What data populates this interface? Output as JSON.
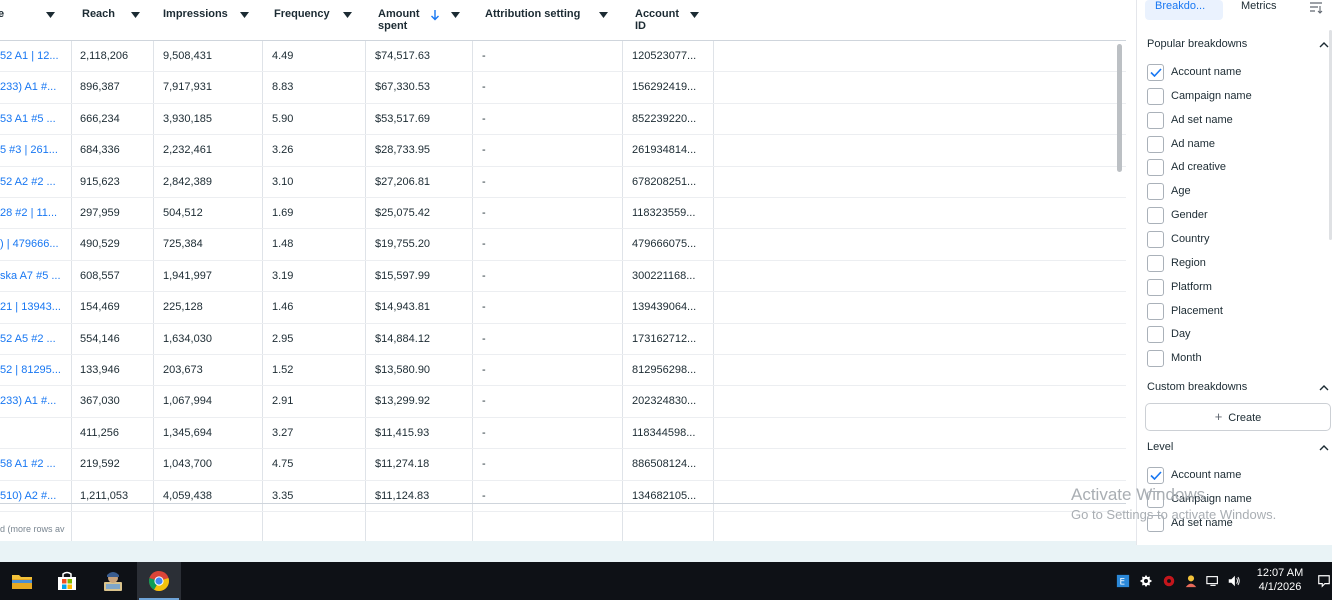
{
  "table": {
    "columns": [
      {
        "key": "name",
        "label": "e"
      },
      {
        "key": "reach",
        "label": "Reach"
      },
      {
        "key": "impressions",
        "label": "Impressions"
      },
      {
        "key": "frequency",
        "label": "Frequency"
      },
      {
        "key": "amount_spent",
        "label": "Amount spent",
        "sorted": "descending"
      },
      {
        "key": "attribution",
        "label": "Attribution setting"
      },
      {
        "key": "account_id",
        "label": "Account ID"
      }
    ],
    "rows": [
      {
        "name": "52 A1 | 12...",
        "reach": "2,118,206",
        "impressions": "9,508,431",
        "frequency": "4.49",
        "amount_spent": "$74,517.63",
        "attribution": "-",
        "account_id": "120523077..."
      },
      {
        "name": "233) A1 #...",
        "reach": "896,387",
        "impressions": "7,917,931",
        "frequency": "8.83",
        "amount_spent": "$67,330.53",
        "attribution": "-",
        "account_id": "156292419..."
      },
      {
        "name": "53 A1 #5 ...",
        "reach": "666,234",
        "impressions": "3,930,185",
        "frequency": "5.90",
        "amount_spent": "$53,517.69",
        "attribution": "-",
        "account_id": "852239220..."
      },
      {
        "name": "5 #3 | 261...",
        "reach": "684,336",
        "impressions": "2,232,461",
        "frequency": "3.26",
        "amount_spent": "$28,733.95",
        "attribution": "-",
        "account_id": "261934814..."
      },
      {
        "name": "52 A2 #2 ...",
        "reach": "915,623",
        "impressions": "2,842,389",
        "frequency": "3.10",
        "amount_spent": "$27,206.81",
        "attribution": "-",
        "account_id": "678208251..."
      },
      {
        "name": "28 #2 | 11...",
        "reach": "297,959",
        "impressions": "504,512",
        "frequency": "1.69",
        "amount_spent": "$25,075.42",
        "attribution": "-",
        "account_id": "118323559..."
      },
      {
        "name": ") | 479666...",
        "reach": "490,529",
        "impressions": "725,384",
        "frequency": "1.48",
        "amount_spent": "$19,755.20",
        "attribution": "-",
        "account_id": "479666075..."
      },
      {
        "name": "ska A7 #5 ...",
        "reach": "608,557",
        "impressions": "1,941,997",
        "frequency": "3.19",
        "amount_spent": "$15,597.99",
        "attribution": "-",
        "account_id": "300221168..."
      },
      {
        "name": "21 | 13943...",
        "reach": "154,469",
        "impressions": "225,128",
        "frequency": "1.46",
        "amount_spent": "$14,943.81",
        "attribution": "-",
        "account_id": "139439064..."
      },
      {
        "name": "52 A5 #2 ...",
        "reach": "554,146",
        "impressions": "1,634,030",
        "frequency": "2.95",
        "amount_spent": "$14,884.12",
        "attribution": "-",
        "account_id": "173162712..."
      },
      {
        "name": "52 | 81295...",
        "reach": "133,946",
        "impressions": "203,673",
        "frequency": "1.52",
        "amount_spent": "$13,580.90",
        "attribution": "-",
        "account_id": "812956298..."
      },
      {
        "name": "233) A1 #...",
        "reach": "367,030",
        "impressions": "1,067,994",
        "frequency": "2.91",
        "amount_spent": "$13,299.92",
        "attribution": "-",
        "account_id": "202324830..."
      },
      {
        "name": "",
        "reach": "411,256",
        "impressions": "1,345,694",
        "frequency": "3.27",
        "amount_spent": "$11,415.93",
        "attribution": "-",
        "account_id": "118344598..."
      },
      {
        "name": "58 A1 #2 ...",
        "reach": "219,592",
        "impressions": "1,043,700",
        "frequency": "4.75",
        "amount_spent": "$11,274.18",
        "attribution": "-",
        "account_id": "886508124..."
      },
      {
        "name": "510) A2 #...",
        "reach": "1,211,053",
        "impressions": "4,059,438",
        "frequency": "3.35",
        "amount_spent": "$11,124.83",
        "attribution": "-",
        "account_id": "134682105..."
      }
    ],
    "footer_text": "d (more rows av"
  },
  "panel": {
    "tabs": {
      "breakdowns": "Breakdo...",
      "metrics": "Metrics"
    },
    "popular_title": "Popular breakdowns",
    "popular": [
      {
        "label": "Account name",
        "checked": true
      },
      {
        "label": "Campaign name",
        "checked": false
      },
      {
        "label": "Ad set name",
        "checked": false
      },
      {
        "label": "Ad name",
        "checked": false
      },
      {
        "label": "Ad creative",
        "checked": false
      },
      {
        "label": "Age",
        "checked": false
      },
      {
        "label": "Gender",
        "checked": false
      },
      {
        "label": "Country",
        "checked": false
      },
      {
        "label": "Region",
        "checked": false
      },
      {
        "label": "Platform",
        "checked": false
      },
      {
        "label": "Placement",
        "checked": false
      },
      {
        "label": "Day",
        "checked": false
      },
      {
        "label": "Month",
        "checked": false
      }
    ],
    "custom_title": "Custom breakdowns",
    "create_label": "Create",
    "level_title": "Level",
    "level": [
      {
        "label": "Account name",
        "checked": true
      },
      {
        "label": "Campaign name",
        "checked": false
      },
      {
        "label": "Ad set name",
        "checked": false
      }
    ]
  },
  "watermark": {
    "title": "Activate Windows",
    "subtitle": "Go to Settings to activate Windows."
  },
  "taskbar": {
    "apps": [
      {
        "name": "file-explorer",
        "active": false
      },
      {
        "name": "microsoft-store",
        "active": false
      },
      {
        "name": "user-app",
        "active": false
      },
      {
        "name": "chrome",
        "active": true
      }
    ],
    "time": "12:07 AM",
    "date": "4/1/2026"
  },
  "colors": {
    "link": "#1877f2",
    "accent": "#1877f2",
    "taskbar": "#0e1116"
  }
}
